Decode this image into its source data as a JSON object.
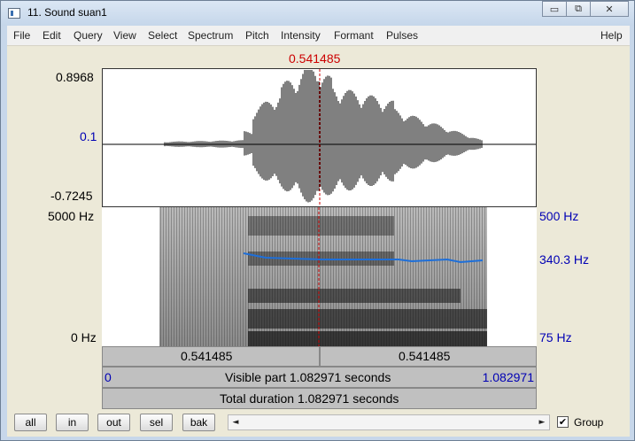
{
  "window": {
    "title": "11. Sound suan1",
    "minimize_glyph": "▭",
    "maximize_glyph": "⧉",
    "close_glyph": "✕"
  },
  "menu": [
    "File",
    "Edit",
    "Query",
    "View",
    "Select",
    "Spectrum",
    "Pitch",
    "Intensity",
    "Formant",
    "Pulses",
    "Help"
  ],
  "cursor": {
    "time_label": "0.541485"
  },
  "waveform": {
    "y_max": "0.8968",
    "y_mid": "0.1",
    "y_min": "-0.7245"
  },
  "spectrogram": {
    "f_max": "5000 Hz",
    "f_min": "0 Hz",
    "pitch_max": "500 Hz",
    "pitch_current": "340.3 Hz",
    "pitch_min": "75 Hz"
  },
  "duration_bars": {
    "left_segment": "0.541485",
    "right_segment": "0.541485",
    "visible_start": "0",
    "visible_text": "Visible part 1.082971 seconds",
    "visible_end": "1.082971",
    "total_text": "Total duration 1.082971 seconds"
  },
  "buttons": {
    "all": "all",
    "in": "in",
    "out": "out",
    "sel": "sel",
    "bak": "bak"
  },
  "scroll": {
    "left_arrow": "◄",
    "right_arrow": "►"
  },
  "group": {
    "label": "Group",
    "checked": true,
    "check_glyph": "✔"
  },
  "colors": {
    "cursor": "#cc0000",
    "axis_blue": "#0000b4",
    "pitch_line": "#1e6fd9"
  }
}
